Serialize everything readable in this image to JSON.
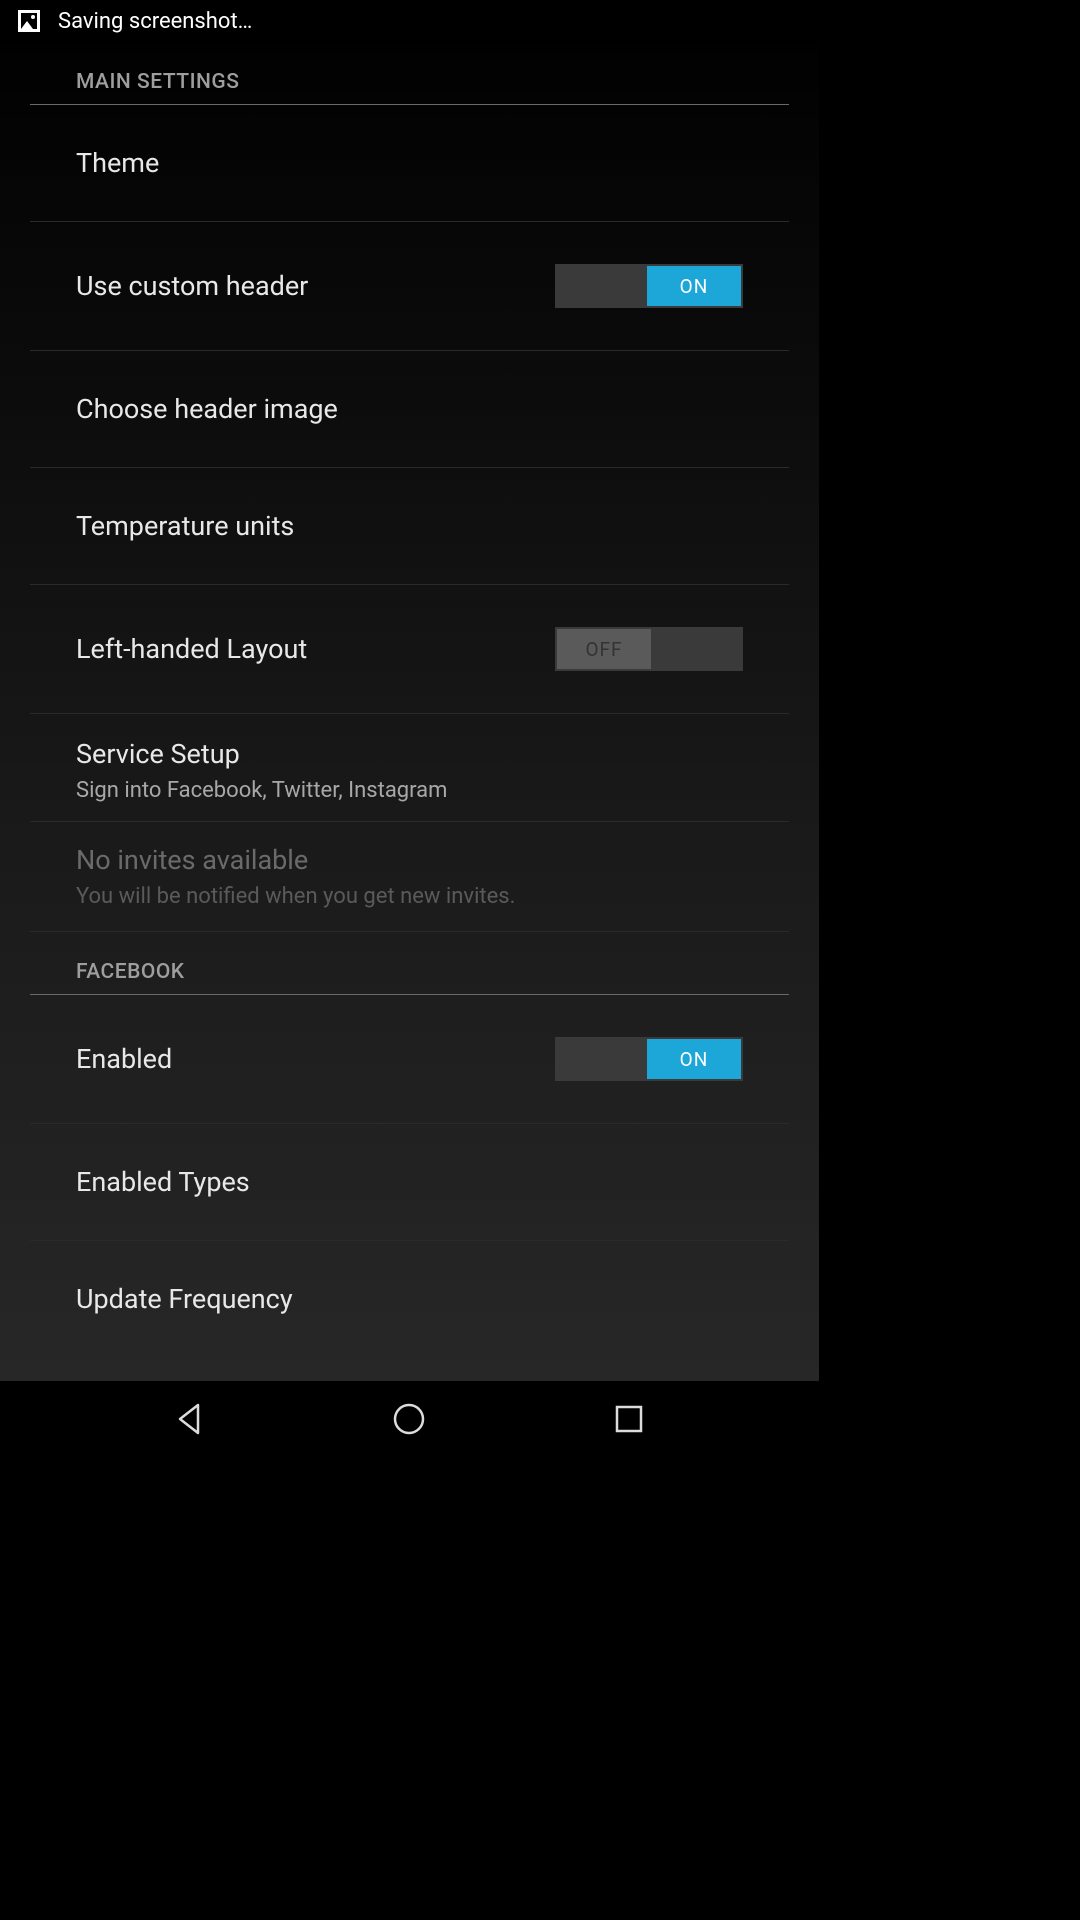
{
  "statusBar": {
    "text": "Saving screenshot…"
  },
  "sections": {
    "main": {
      "header": "MAIN SETTINGS",
      "items": {
        "theme": {
          "title": "Theme"
        },
        "customHeader": {
          "title": "Use custom header",
          "toggle": "ON"
        },
        "headerImage": {
          "title": "Choose header image"
        },
        "tempUnits": {
          "title": "Temperature units"
        },
        "leftHanded": {
          "title": "Left-handed Layout",
          "toggle": "OFF"
        },
        "serviceSetup": {
          "title": "Service Setup",
          "subtitle": "Sign into Facebook, Twitter, Instagram"
        },
        "invites": {
          "title": "No invites available",
          "subtitle": "You will be notified when you get new invites."
        }
      }
    },
    "facebook": {
      "header": "FACEBOOK",
      "items": {
        "enabled": {
          "title": "Enabled",
          "toggle": "ON"
        },
        "enabledTypes": {
          "title": "Enabled Types"
        },
        "updateFrequency": {
          "title": "Update Frequency"
        }
      }
    }
  }
}
